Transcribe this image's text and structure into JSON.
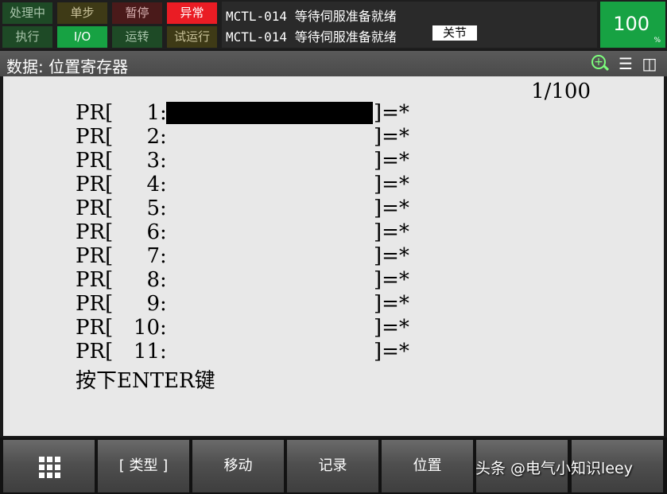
{
  "status": {
    "leds_row1": [
      "处理中",
      "单步",
      "暂停",
      "异常"
    ],
    "leds_row2": [
      "执行",
      "I/O",
      "运转",
      "试运行"
    ],
    "colors": {
      "active_green": "#17a243",
      "alarm_red": "#ea1c24"
    }
  },
  "messages": {
    "line1": "MCTL-014 等待伺服准备就绪",
    "line2": "MCTL-014 等待伺服准备就绪",
    "jog_mode": "关节"
  },
  "override": {
    "value": "100",
    "unit": "%"
  },
  "screen": {
    "title": "数据: 位置寄存器",
    "icons": [
      "zoom-in-icon",
      "menu-icon",
      "split-screen-icon"
    ]
  },
  "registers": {
    "page_indicator": "1/100",
    "rows": [
      {
        "prefix": "PR[",
        "index": "1",
        "suffix": "]=*",
        "selected": true
      },
      {
        "prefix": "PR[",
        "index": "2",
        "suffix": "]=*"
      },
      {
        "prefix": "PR[",
        "index": "3",
        "suffix": "]=*"
      },
      {
        "prefix": "PR[",
        "index": "4",
        "suffix": "]=*"
      },
      {
        "prefix": "PR[",
        "index": "5",
        "suffix": "]=*"
      },
      {
        "prefix": "PR[",
        "index": "6",
        "suffix": "]=*"
      },
      {
        "prefix": "PR[",
        "index": "7",
        "suffix": "]=*"
      },
      {
        "prefix": "PR[",
        "index": "8",
        "suffix": "]=*"
      },
      {
        "prefix": "PR[",
        "index": "9",
        "suffix": "]=*"
      },
      {
        "prefix": "PR[",
        "index": "10",
        "suffix": "]=*"
      },
      {
        "prefix": "PR[",
        "index": "11",
        "suffix": "]=*"
      }
    ],
    "prompt": "按下ENTER键"
  },
  "function_keys": {
    "f0_icon": "grid-menu-icon",
    "f1": "[ 类型 ]",
    "f2": "移动",
    "f3": "记录",
    "f4": "位置",
    "f5": "",
    "f6": ""
  },
  "watermark": "头条 @电气小知识leey"
}
